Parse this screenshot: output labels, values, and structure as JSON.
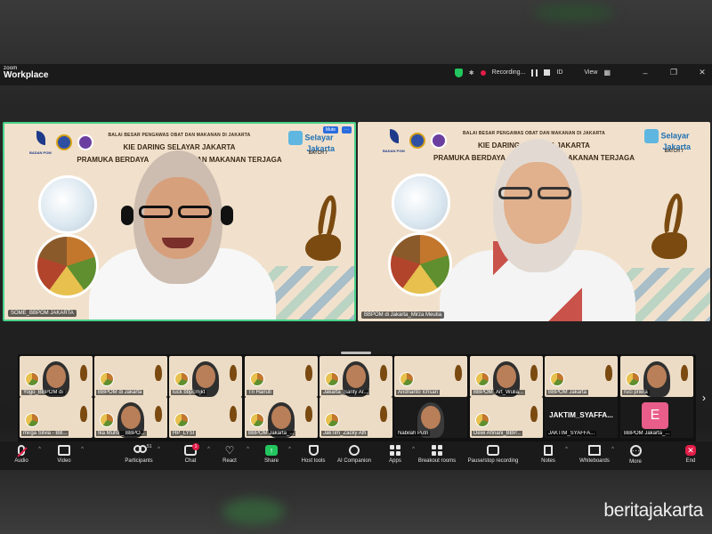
{
  "app": {
    "brand_small": "zoom",
    "brand_name": "Workplace"
  },
  "titlebar": {
    "recording_label": "Recording...",
    "id_label": "ID",
    "view_label": "View"
  },
  "slide": {
    "org": "BALAI BESAR PENGAWAS OBAT DAN MAKANAN DI JAKARTA",
    "title_line1": "KIE DARING SELAYAR JAKARTA",
    "title_line2_left": "PRAMUKA BERDAYA",
    "title_line2_right": "DAN MAKANAN TERJAGA",
    "title_line2_right_b": "AKANAN TERJAGA",
    "selayar_1": "Selayar",
    "selayar_2": "Jakarta",
    "batch": "BATCH 7",
    "badan_pom": "BADAN POM"
  },
  "tiles": [
    {
      "name": "SOME_BBPOM JAKARTA",
      "mute_label": "Mute",
      "more_label": "···"
    },
    {
      "name": "BBPOM di Jakarta_Mirza Meutia"
    }
  ],
  "gallery": {
    "row1": [
      "Yogo_BBPOM di",
      "BBPOM di Jakarta",
      "luck bbpcmjkt",
      "Tri Hairuti",
      "Jakarta_Santy Ar...",
      "Andrianto Ichsan",
      "BBPOM_Art_Wulia...",
      "BBPOM Jakarta",
      "ruci priera"
    ],
    "row2": [
      "mirga Silvia - BB...",
      "Ika Muhti _ BBPO...",
      "HP_LYSI",
      "BBPOM Jakarta_...",
      "JakTim_Zacky Alfi",
      "Nabilah Putri",
      "Dewi Ahriani_BBP...",
      "JAKTIM_SYAFFA...",
      "BBPOM Jakarta_..."
    ],
    "big_name": "JAKTIM_SYAFFA...",
    "avatar_letter": "E",
    "next_arrow": "›"
  },
  "toolbar": {
    "audio": "Audio",
    "video": "Video",
    "participants": "Participants",
    "participants_count": "51",
    "chat": "Chat",
    "chat_badge": "1",
    "react": "React",
    "share": "Share",
    "host_tools": "Host tools",
    "ai_companion": "AI Companion",
    "apps": "Apps",
    "breakout": "Breakout rooms",
    "pause_rec": "Pause/stop recording",
    "notes": "Notes",
    "whiteboards": "Whiteboards",
    "more": "More",
    "end": "End"
  },
  "watermark": "beritajakarta",
  "colors": {
    "active_border": "#48d18a",
    "share_green": "#22c55e",
    "end_red": "#e11d48",
    "avatar_pink": "#e85d8a"
  }
}
